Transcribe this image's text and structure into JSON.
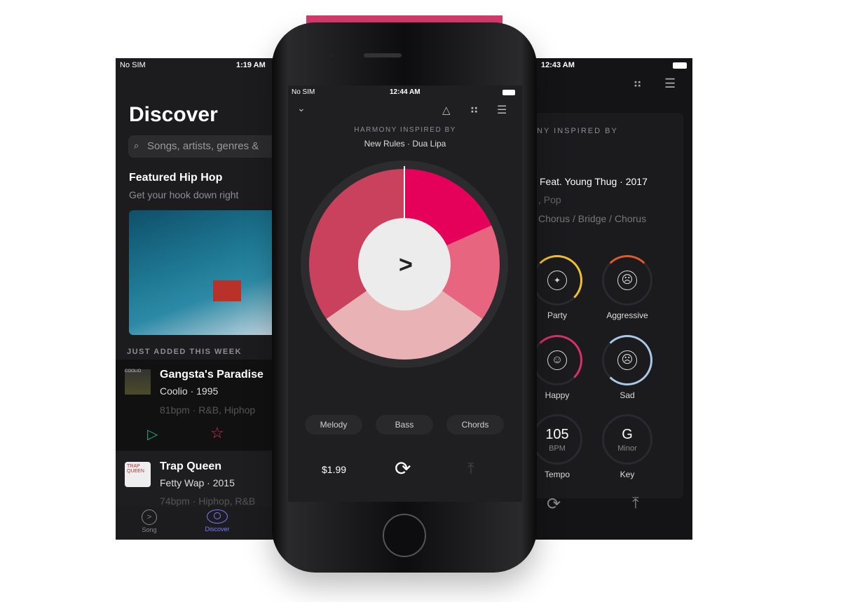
{
  "left_screen": {
    "status": {
      "carrier": "No SIM",
      "time": "1:19 AM"
    },
    "title": "Discover",
    "search_placeholder": "Songs, artists, genres &",
    "featured": {
      "title": "Featured Hip Hop",
      "subtitle": "Get your hook down right"
    },
    "section_label": "JUST ADDED THIS WEEK",
    "songs": [
      {
        "title": "Gangsta's Paradise",
        "artist_year": "Coolio · 1995",
        "meta": "81bpm · R&B, Hiphop",
        "art_text": "COOLIO"
      },
      {
        "title": "Trap Queen",
        "artist_year": "Fetty Wap · 2015",
        "meta": "74bpm · Hiphop, R&B",
        "art_text": "TRAP QUEEN"
      }
    ],
    "tabs": [
      {
        "label": "Song",
        "icon": "play-circle-icon"
      },
      {
        "label": "Discover",
        "icon": "eye-icon",
        "active": true
      }
    ],
    "accent": "#7b7bff"
  },
  "center_screen": {
    "status": {
      "carrier": "No SIM",
      "time": "12:44 AM"
    },
    "inspired_label": "HARMONY INSPIRED BY",
    "inspired_song": "New Rules · Dua Lipa",
    "wheel_colors": [
      "#e5005a",
      "#e86580",
      "#e9b3b6",
      "#c9415d"
    ],
    "parts": [
      "Melody",
      "Bass",
      "Chords"
    ],
    "price": "$1.99"
  },
  "right_screen": {
    "status": {
      "time": "12:43 AM"
    },
    "inspired_label": "NY INSPIRED BY",
    "line1": "Feat. Young Thug · 2017",
    "line2": ", Pop",
    "line3": "Chorus / Bridge / Chorus",
    "moods": [
      {
        "label": "Party",
        "color": "#f0c030"
      },
      {
        "label": "Aggressive",
        "color": "#e05a2a"
      },
      {
        "label": "Happy",
        "color": "#d8306a"
      },
      {
        "label": "Sad",
        "color": "#a9c8e8"
      }
    ],
    "tempo": {
      "value": "105",
      "unit": "BPM",
      "label": "Tempo"
    },
    "key": {
      "value": "G",
      "unit": "Minor",
      "label": "Key"
    }
  },
  "brand_color": "#d63a6c"
}
